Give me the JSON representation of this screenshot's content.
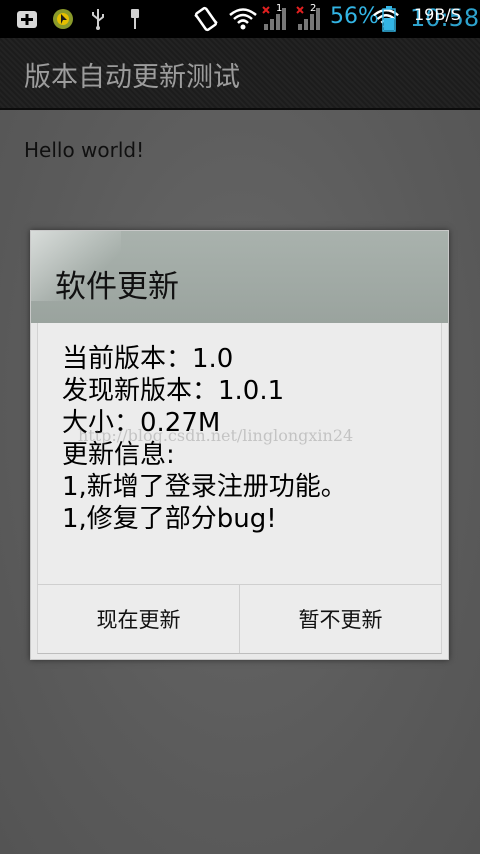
{
  "status_bar": {
    "battery_percent": "56%",
    "speed": "19B/S",
    "time": "10:58",
    "signal_labels": [
      "1",
      "2"
    ],
    "icons": [
      "plus-box-icon",
      "cursor-app-icon",
      "usb-icon",
      "usb-debug-icon",
      "vibrate-icon",
      "wifi-icon",
      "signal-sim1-icon",
      "signal-sim2-icon",
      "wifi-icon-2",
      "battery-icon"
    ]
  },
  "action_bar": {
    "title": "版本自动更新测试"
  },
  "content": {
    "hello": "Hello world!"
  },
  "dialog": {
    "title": "软件更新",
    "lines": [
      "当前版本：1.0",
      "发现新版本：1.0.1",
      "大小：0.27M",
      "更新信息:",
      "1,新增了登录注册功能。",
      "1,修复了部分bug!"
    ],
    "watermark": "http://blog.csdn.net/linglongxin24",
    "positive_button": "现在更新",
    "negative_button": "暂不更新"
  },
  "colors": {
    "accent": "#33b5e5",
    "dialog_header": "#a3aca7",
    "dialog_body": "#ececec"
  }
}
